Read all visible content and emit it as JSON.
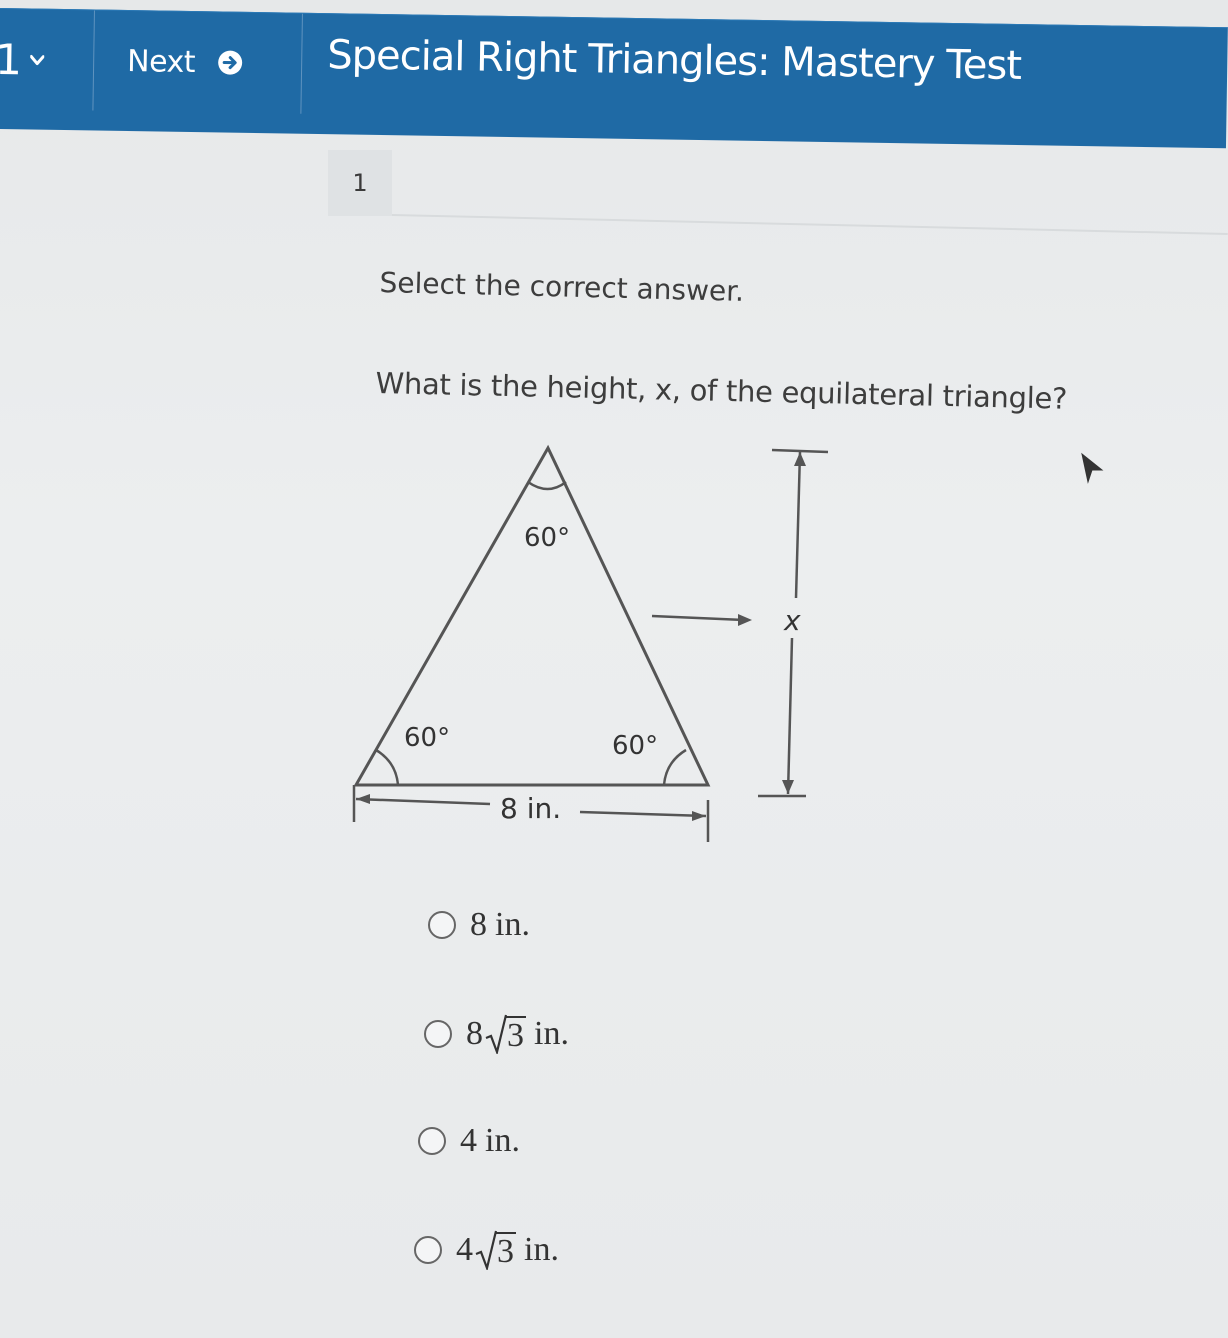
{
  "header": {
    "question_number": "1",
    "next_label": "Next",
    "test_title": "Special Right Triangles: Mastery Test"
  },
  "question_tab": "1",
  "instruction": "Select the correct answer.",
  "question": "What is the height, x, of the equilateral triangle?",
  "diagram": {
    "top_angle": "60°",
    "left_angle": "60°",
    "right_angle": "60°",
    "base_label": "8 in.",
    "height_label": "x"
  },
  "options": [
    {
      "coefficient": "8",
      "radicand": "",
      "unit": "in.",
      "text": "8 in."
    },
    {
      "coefficient": "8",
      "radicand": "3",
      "unit": "in.",
      "text": "8√3 in."
    },
    {
      "coefficient": "4",
      "radicand": "",
      "unit": "in.",
      "text": "4 in."
    },
    {
      "coefficient": "4",
      "radicand": "3",
      "unit": "in.",
      "text": "4√3 in."
    }
  ],
  "colors": {
    "header": "#1f6aa5",
    "background": "#e9ebec",
    "text": "#3d3d3d"
  },
  "icons": {
    "question_dropdown": "chevron-down-icon",
    "next": "arrow-circle-right-icon",
    "pointer": "mouse-cursor-icon"
  }
}
